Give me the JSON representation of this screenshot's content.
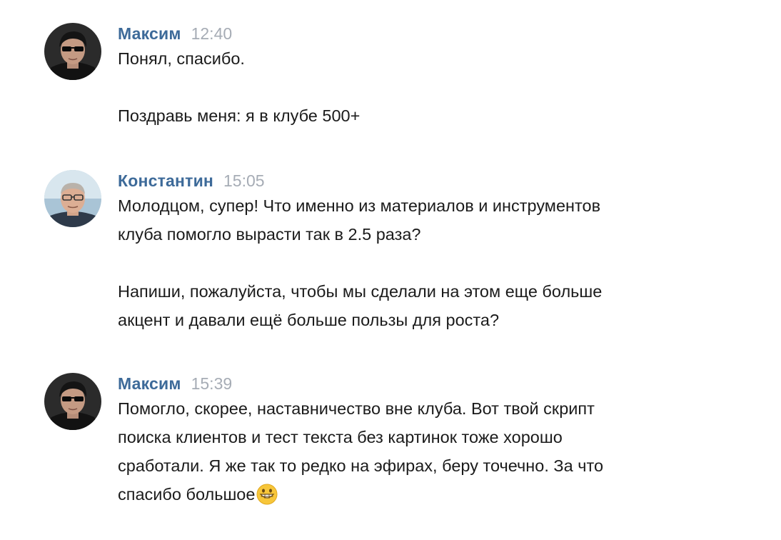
{
  "conversation": {
    "messages": [
      {
        "author": "Максим",
        "time": "12:40",
        "avatar_icon": "user-avatar-sunglasses",
        "paragraphs": [
          [
            "Понял, спасибо."
          ],
          [
            "Поздравь меня: я в клубе 500+"
          ]
        ]
      },
      {
        "author": "Константин",
        "time": "15:05",
        "avatar_icon": "user-avatar-glasses",
        "paragraphs": [
          [
            "Молодцом, супер! Что именно из материалов и инструментов",
            "клуба помогло вырасти так в 2.5 раза?"
          ],
          [
            "Напиши, пожалуйста, чтобы мы сделали на этом еще больше",
            "акцент и давали ещё больше пользы для роста?"
          ]
        ]
      },
      {
        "author": "Максим",
        "time": "15:39",
        "avatar_icon": "user-avatar-sunglasses",
        "paragraphs": [
          [
            "Помогло, скорее, наставничество вне клуба. Вот твой скрипт",
            "поиска клиентов и тест текста без картинок тоже хорошо",
            "сработали. Я же так то редко на эфирах, беру точечно. За что",
            "спасибо большое"
          ]
        ],
        "trailing_emoji": "grinning-face-emoji"
      }
    ]
  },
  "colors": {
    "author": "#3d6a99",
    "time": "#a6acb5",
    "text": "#1b1b1b",
    "background": "#ffffff"
  }
}
